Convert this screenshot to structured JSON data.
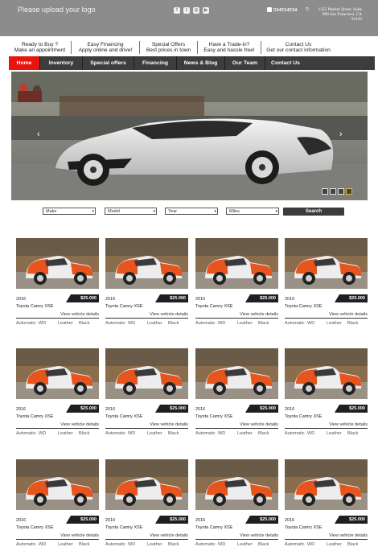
{
  "header": {
    "logo_text": "Please upload your logo",
    "social_icons": [
      "facebook-icon",
      "twitter-icon",
      "instagram-icon",
      "youtube-icon"
    ],
    "phone": "534534534",
    "address_line1": "1355 Market Street, Suite",
    "address_line2": "900 San Francisco, CA",
    "address_line3": "94103"
  },
  "promos": [
    {
      "title": "Ready to Buy ?",
      "sub": "Make an appointment"
    },
    {
      "title": "Easy Financing",
      "sub": "Apply online and drive!"
    },
    {
      "title": "Special Offers",
      "sub": "Best prices in town"
    },
    {
      "title": "Have a Trade-in?",
      "sub": "Easy and hassle free!"
    },
    {
      "title": "Contact Us",
      "sub": "Get our contact information"
    }
  ],
  "nav": [
    "Home",
    "Inventory",
    "Special offers",
    "Financing",
    "News & Blog",
    "Our Team",
    "Contact Us"
  ],
  "nav_active": "Home",
  "slider": {
    "prev": "‹",
    "next": "›",
    "slide_count": 4,
    "active_slide": 4
  },
  "search": {
    "make": "Make",
    "model": "Model",
    "year": "Year",
    "miles": "Miles",
    "button": "Search"
  },
  "listing": {
    "year": "2016",
    "price": "$25.000",
    "model": "Toyota Camry XSE",
    "view_label": "View vehicle details",
    "transmission": "Automatic",
    "drive": "WD",
    "interior": "Leather",
    "color": "Black"
  },
  "colors": {
    "accent": "#e8140e",
    "nav": "#3d3d3d",
    "header": "#8c8c8c",
    "slider_dot_active": "#e6b91e"
  }
}
